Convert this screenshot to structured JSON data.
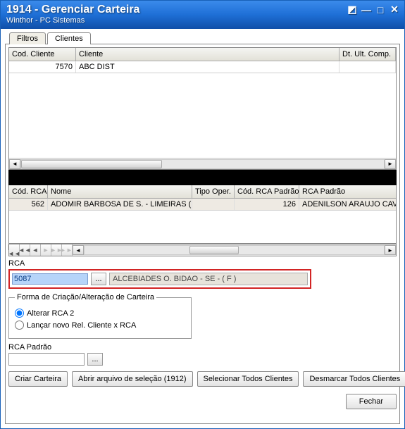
{
  "window": {
    "title": "1914 - Gerenciar Carteira",
    "subtitle": "Winthor - PC Sistemas"
  },
  "tabs": {
    "filtros": "Filtros",
    "clientes": "Clientes"
  },
  "clientes_grid": {
    "headers": {
      "cod_cliente": "Cod. Cliente",
      "cliente": "Cliente",
      "dt_ult_comp": "Dt. Ult. Comp."
    },
    "rows": [
      {
        "cod_cliente": "7570",
        "cliente": "ABC DIST",
        "dt_ult_comp": ""
      }
    ]
  },
  "rca_grid": {
    "headers": {
      "cod_rca": "Cód. RCA",
      "nome": "Nome",
      "tipo_oper": "Tipo Oper.",
      "cod_rca_padrao": "Cód. RCA Padrão",
      "rca_padrao": "RCA Padrão"
    },
    "rows": [
      {
        "cod_rca": "562",
        "nome": "ADOMIR BARBOSA DE S. - LIMEIRAS ( V )",
        "tipo_oper": "",
        "cod_rca_padrao": "126",
        "rca_padrao": "ADENILSON ARAUJO CAVA"
      }
    ]
  },
  "rca": {
    "label": "RCA",
    "code": "5087",
    "name": "ALCEBIADES O. BIDAO - SE - ( F )"
  },
  "forma": {
    "legend": "Forma de Criação/Alteração de Carteira",
    "opt1": "Alterar RCA 2",
    "opt2": "Lançar novo Rel. Cliente x RCA"
  },
  "rca_padrao": {
    "label": "RCA Padrão",
    "code": ""
  },
  "buttons": {
    "criar_carteira": "Criar Carteira",
    "abrir_arquivo": "Abrir arquivo de seleção (1912)",
    "selecionar_todos": "Selecionar Todos Clientes",
    "desmarcar_todos": "Desmarcar Todos Clientes",
    "fechar": "Fechar"
  },
  "lookup_label": "..."
}
